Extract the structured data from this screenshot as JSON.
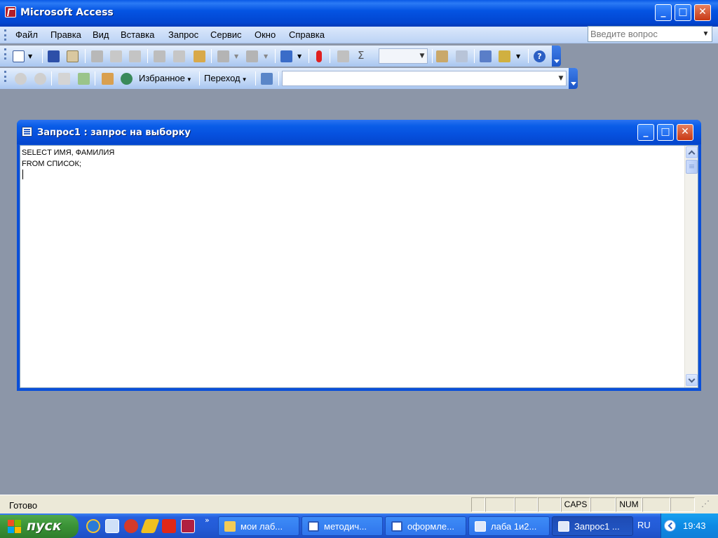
{
  "app": {
    "title": "Microsoft Access",
    "window_buttons": {
      "minimize": "_",
      "maximize": "□",
      "close": "✕"
    }
  },
  "menubar": {
    "items": [
      "Файл",
      "Правка",
      "Вид",
      "Вставка",
      "Запрос",
      "Сервис",
      "Окно",
      "Справка"
    ],
    "ask_placeholder": "Введите вопрос"
  },
  "toolbar_web": {
    "favorites_label": "Избранное",
    "go_label": "Переход",
    "address_value": ""
  },
  "query_window": {
    "title": "Запрос1 : запрос на выборку",
    "sql_lines": [
      "SELECT ИМЯ, ФАМИЛИЯ",
      "FROM СПИСОК;"
    ]
  },
  "statusbar": {
    "message": "Готово",
    "caps": "CAPS",
    "num": "NUM"
  },
  "taskbar": {
    "start_label": "пуск",
    "overflow": "»",
    "tasks": [
      {
        "label": "мои лаб...",
        "icon": "folder-icon"
      },
      {
        "label": "методич...",
        "icon": "word-doc-icon"
      },
      {
        "label": "оформле...",
        "icon": "word-doc-icon"
      },
      {
        "label": "лаба 1и2...",
        "icon": "access-db-icon"
      },
      {
        "label": "Запрос1 ...",
        "icon": "access-query-icon"
      }
    ],
    "language": "RU",
    "clock": "19:43"
  }
}
